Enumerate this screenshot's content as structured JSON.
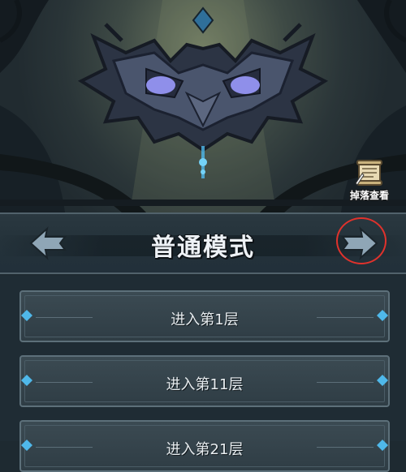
{
  "loot_button": {
    "label": "掉落查看",
    "icon": "scroll-icon"
  },
  "mode_selector": {
    "title": "普通模式",
    "prev_icon": "arrow-left-icon",
    "next_icon": "arrow-right-icon"
  },
  "floors": [
    {
      "label": "进入第1层"
    },
    {
      "label": "进入第11层"
    },
    {
      "label": "进入第21层"
    }
  ],
  "colors": {
    "highlight_ring": "#e0322c",
    "gem_blue": "#4fb8ea",
    "boss_eye": "#8f8fea"
  }
}
